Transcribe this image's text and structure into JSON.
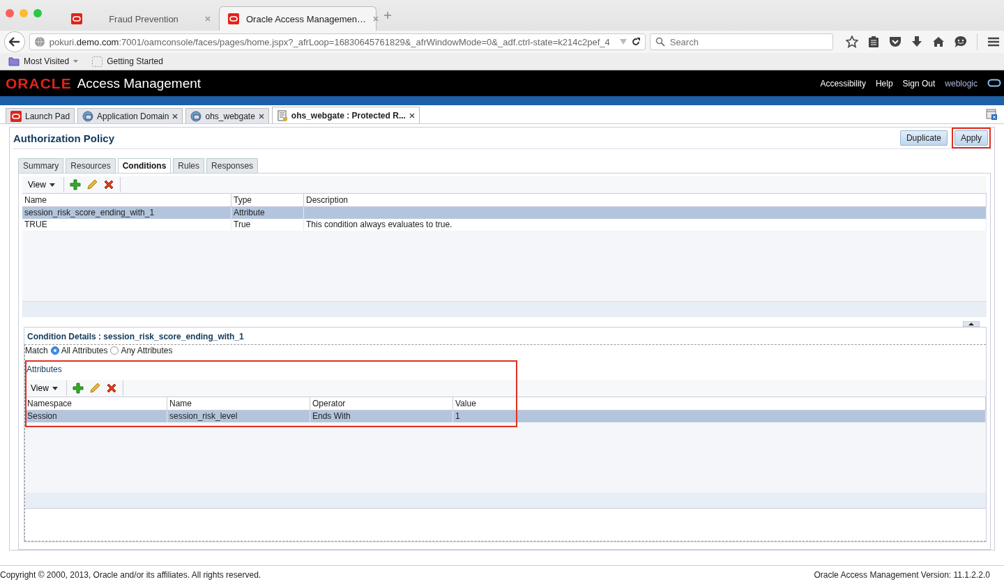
{
  "browser": {
    "tabs": [
      {
        "title": "Fraud Prevention",
        "selected": false
      },
      {
        "title": "Oracle Access Managemen…",
        "selected": true
      }
    ],
    "url": "pokuri.**demo.com**:7001/oamconsole/faces/pages/home.jspx?_afrLoop=16830645761829&_afrWindowMode=0&_adf.ctrl-state=k214c2pef_4",
    "search": {
      "placeholder": "Search"
    },
    "bookmarks": [
      {
        "label": "Most Visited",
        "kind": "folder"
      },
      {
        "label": "Getting Started",
        "kind": "page"
      }
    ]
  },
  "header": {
    "logo": "ORACLE",
    "title": "Access Management",
    "links": [
      "Accessibility",
      "Help",
      "Sign Out"
    ],
    "user": "weblogic"
  },
  "page_tabs": [
    {
      "label": "Launch Pad",
      "kind": "launch",
      "closable": false,
      "selected": false
    },
    {
      "label": "Application Domain",
      "kind": "domain",
      "closable": true,
      "selected": false
    },
    {
      "label": "ohs_webgate",
      "kind": "domain",
      "closable": true,
      "selected": false
    },
    {
      "label": "ohs_webgate : Protected R...",
      "kind": "policy",
      "closable": true,
      "selected": true
    }
  ],
  "panel": {
    "title": "Authorization Policy",
    "buttons": [
      {
        "label": "Duplicate",
        "highlighted": false
      },
      {
        "label": "Apply",
        "highlighted": true
      }
    ],
    "tabs": [
      {
        "label": "Summary",
        "selected": false
      },
      {
        "label": "Resources",
        "selected": false
      },
      {
        "label": "Conditions",
        "selected": true
      },
      {
        "label": "Rules",
        "selected": false
      },
      {
        "label": "Responses",
        "selected": false
      }
    ],
    "conditions": {
      "view_label": "View",
      "columns": [
        "Name",
        "Type",
        "Description"
      ],
      "rows": [
        {
          "cells": [
            "session_risk_score_ending_with_1",
            "Attribute",
            ""
          ],
          "selected": true
        },
        {
          "cells": [
            "TRUE",
            "True",
            "This condition always evaluates to true."
          ],
          "selected": false
        }
      ]
    },
    "details": {
      "title": "Condition Details : session_risk_score_ending_with_1",
      "match_label": "Match",
      "match_options": [
        {
          "label": "All Attributes",
          "selected": true
        },
        {
          "label": "Any Attributes",
          "selected": false
        }
      ],
      "attributes_label": "Attributes",
      "highlighted": true,
      "view_label": "View",
      "columns": [
        "Namespace",
        "Name",
        "Operator",
        "Value"
      ],
      "rows": [
        {
          "cells": [
            "Session",
            "session_risk_level",
            "Ends With",
            "1"
          ],
          "selected": true
        }
      ]
    }
  },
  "footer": {
    "copyright": "Copyright © 2000, 2013, Oracle and/or its affiliates. All rights reserved.",
    "version": "Oracle Access Management Version: 11.1.2.2.0"
  }
}
